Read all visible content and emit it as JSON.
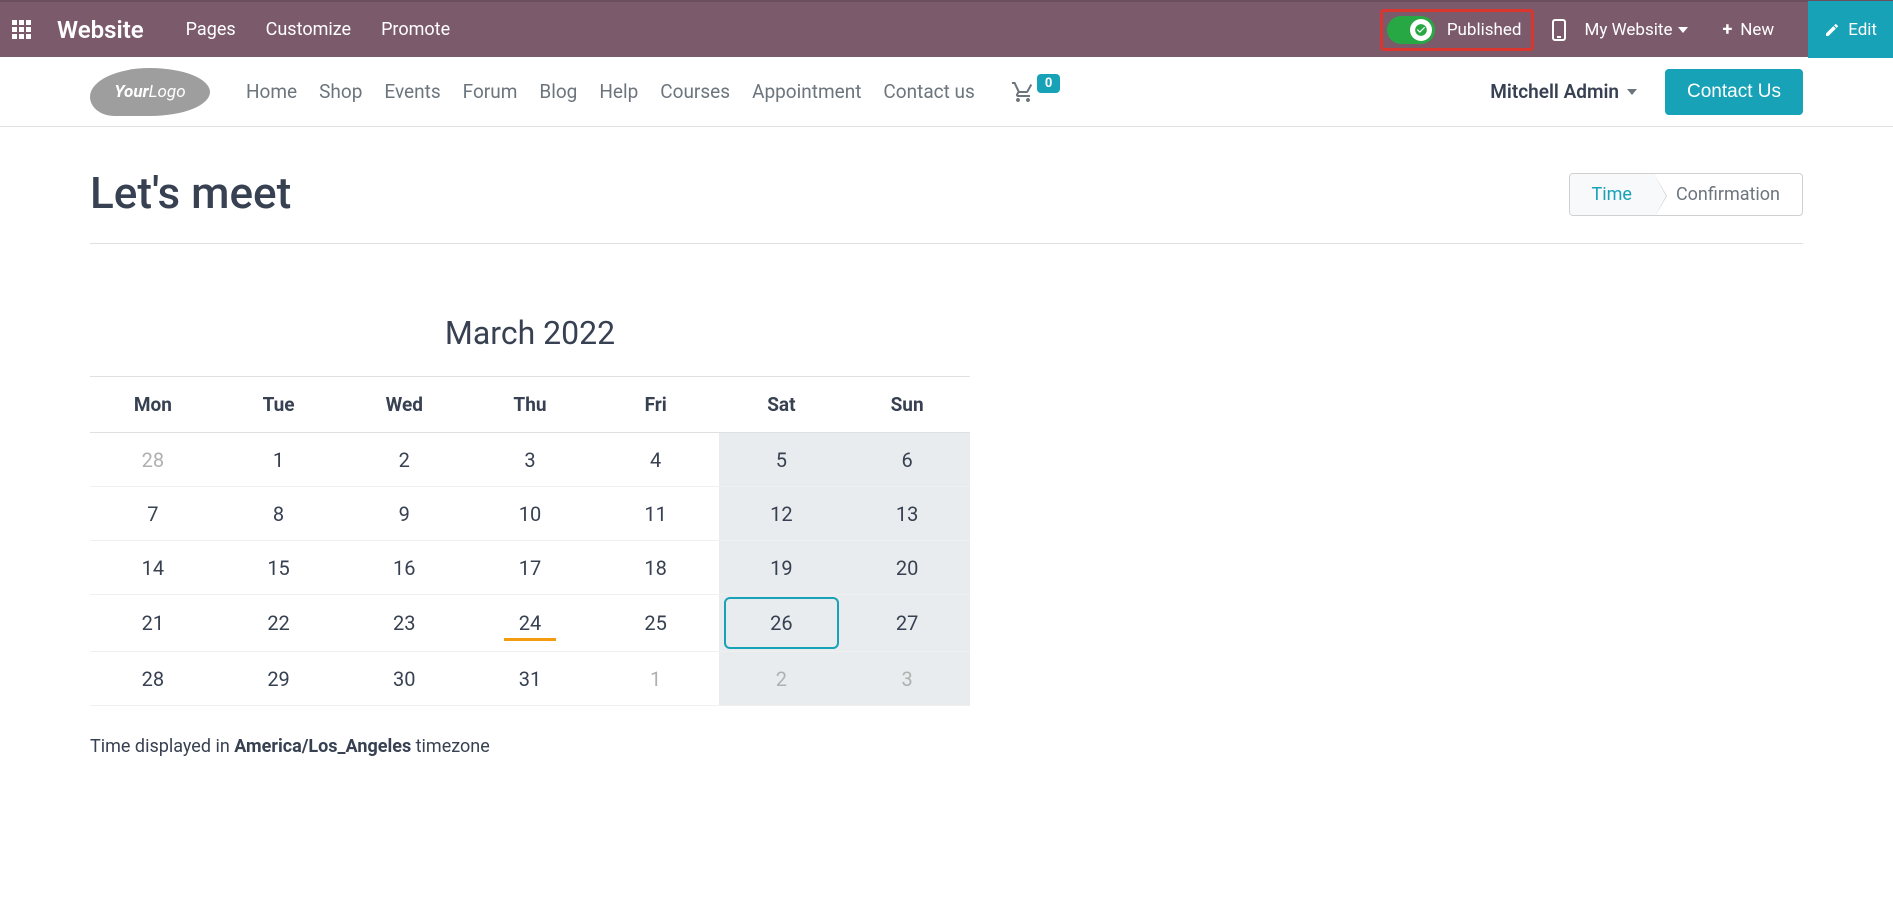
{
  "topbar": {
    "brand": "Website",
    "nav": [
      "Pages",
      "Customize",
      "Promote"
    ],
    "published_label": "Published",
    "website_selector": "My Website",
    "new_label": "New",
    "edit_label": "Edit"
  },
  "site_header": {
    "logo_your": "Your",
    "logo_logo": "Logo",
    "nav": [
      "Home",
      "Shop",
      "Events",
      "Forum",
      "Blog",
      "Help",
      "Courses",
      "Appointment",
      "Contact us"
    ],
    "cart_count": "0",
    "user": "Mitchell Admin",
    "contact_btn": "Contact Us"
  },
  "page": {
    "title": "Let's meet",
    "steps": {
      "time": "Time",
      "confirmation": "Confirmation"
    }
  },
  "calendar": {
    "title": "March 2022",
    "weekdays": [
      "Mon",
      "Tue",
      "Wed",
      "Thu",
      "Fri",
      "Sat",
      "Sun"
    ],
    "rows": [
      [
        {
          "v": "28",
          "other": true
        },
        {
          "v": "1"
        },
        {
          "v": "2"
        },
        {
          "v": "3"
        },
        {
          "v": "4"
        },
        {
          "v": "5",
          "shaded": true
        },
        {
          "v": "6",
          "shaded": true
        }
      ],
      [
        {
          "v": "7"
        },
        {
          "v": "8"
        },
        {
          "v": "9"
        },
        {
          "v": "10"
        },
        {
          "v": "11"
        },
        {
          "v": "12",
          "shaded": true
        },
        {
          "v": "13",
          "shaded": true
        }
      ],
      [
        {
          "v": "14"
        },
        {
          "v": "15"
        },
        {
          "v": "16"
        },
        {
          "v": "17"
        },
        {
          "v": "18"
        },
        {
          "v": "19",
          "shaded": true
        },
        {
          "v": "20",
          "shaded": true
        }
      ],
      [
        {
          "v": "21"
        },
        {
          "v": "22"
        },
        {
          "v": "23"
        },
        {
          "v": "24",
          "today": true
        },
        {
          "v": "25"
        },
        {
          "v": "26",
          "shaded": true,
          "selected": true
        },
        {
          "v": "27",
          "shaded": true
        }
      ],
      [
        {
          "v": "28"
        },
        {
          "v": "29"
        },
        {
          "v": "30"
        },
        {
          "v": "31"
        },
        {
          "v": "1",
          "other": true
        },
        {
          "v": "2",
          "shaded": true,
          "other": true
        },
        {
          "v": "3",
          "shaded": true,
          "other": true
        }
      ]
    ]
  },
  "timezone": {
    "prefix": "Time displayed in ",
    "tz": "America/Los_Angeles",
    "suffix": " timezone"
  }
}
